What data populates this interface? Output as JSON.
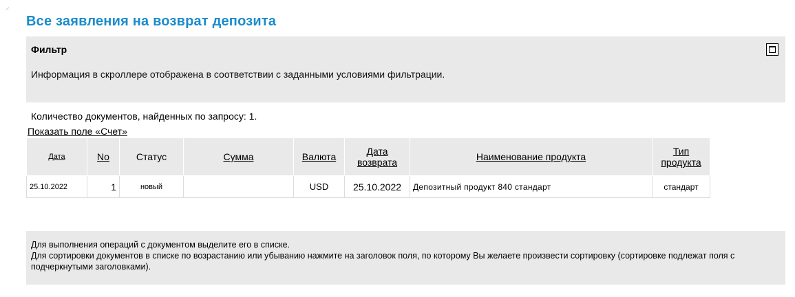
{
  "page": {
    "title": "Все заявления на возврат депозита"
  },
  "filter": {
    "title": "Фильтр",
    "info": "Информация в скроллере отображена в соответствии с заданными условиями фильтрации.",
    "expand_icon": "window-maximize-icon"
  },
  "results": {
    "count_label": "Количество  документов, найденных по запросу:",
    "count_value": "1."
  },
  "show_account_link": "Показать поле «Счет»",
  "table": {
    "headers": {
      "date": "Дата",
      "no": "No",
      "status": "Статус",
      "sum": "Сумма",
      "currency": "Валюта",
      "return_date_1": "Дата",
      "return_date_2": "возврата",
      "product_name": "Наименование продукта",
      "product_type_1": "Тип",
      "product_type_2": "продукта"
    },
    "rows": [
      {
        "date": "25.10.2022",
        "no": "1",
        "status": "новый",
        "sum": "",
        "currency": "USD",
        "return_date": "25.10.2022",
        "product_name": "Депозитный продукт 840 стандарт",
        "product_type": "стандарт"
      }
    ]
  },
  "help": {
    "line1": "Для выполнения операций с документом выделите его в списке.",
    "line2": "Для сортировки документов в списке по возрастанию или убыванию нажмите на заголовок поля, по которому Вы желаете произвести сортировку (сортировке подлежат поля с подчеркнутыми заголовками)."
  },
  "colors": {
    "title": "#1a8ccc",
    "panel_bg": "#e9e9e9"
  }
}
